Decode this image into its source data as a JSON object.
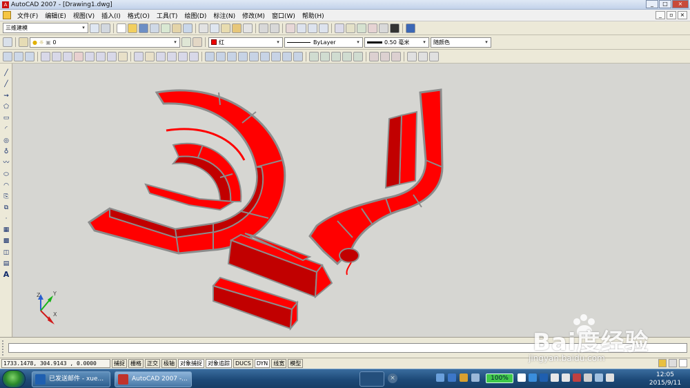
{
  "window": {
    "title": "AutoCAD 2007 - [Drawing1.dwg]",
    "min": "_",
    "max": "□",
    "close": "×"
  },
  "menu": [
    "文件(F)",
    "编辑(E)",
    "视图(V)",
    "插入(I)",
    "格式(O)",
    "工具(T)",
    "绘图(D)",
    "标注(N)",
    "修改(M)",
    "窗口(W)",
    "帮助(H)"
  ],
  "toolbar": {
    "workspace": "三维建模",
    "layer": "0",
    "color": "红",
    "linetype": "ByLayer",
    "lineweight": "0.50 毫米",
    "plotstyle": "随颜色"
  },
  "lefttools": [
    "╱",
    "╱",
    "⇝",
    "⬠",
    "▭",
    "◜",
    "◎",
    "♁",
    "〰",
    "⬭",
    "◠",
    "⎘",
    "⧉",
    "·",
    "▦",
    "▩",
    "◫",
    "▤",
    "A"
  ],
  "ucs": {
    "x": "X",
    "y": "Y",
    "z": "Z"
  },
  "status": {
    "coords": "1733.1478, 304.9143 , 0.0000",
    "buttons": [
      "捕捉",
      "栅格",
      "正交",
      "极轴",
      "对象捕捉",
      "对象追踪",
      "DUCS",
      "DYN",
      "线宽",
      "模型"
    ]
  },
  "taskbar": {
    "tasks": [
      "已发送邮件 - xue...",
      "AutoCAD 2007 -..."
    ],
    "battery": "100%",
    "time": "12:05",
    "date": "2015/9/11"
  },
  "watermark": {
    "brand": "Bai度经验",
    "url": "jingyan.baidu.com"
  },
  "colors": {
    "solid": "#ff0000",
    "edge": "#8c8c8c",
    "shadow": "#c10000",
    "viewport": "#d6d6d2"
  }
}
